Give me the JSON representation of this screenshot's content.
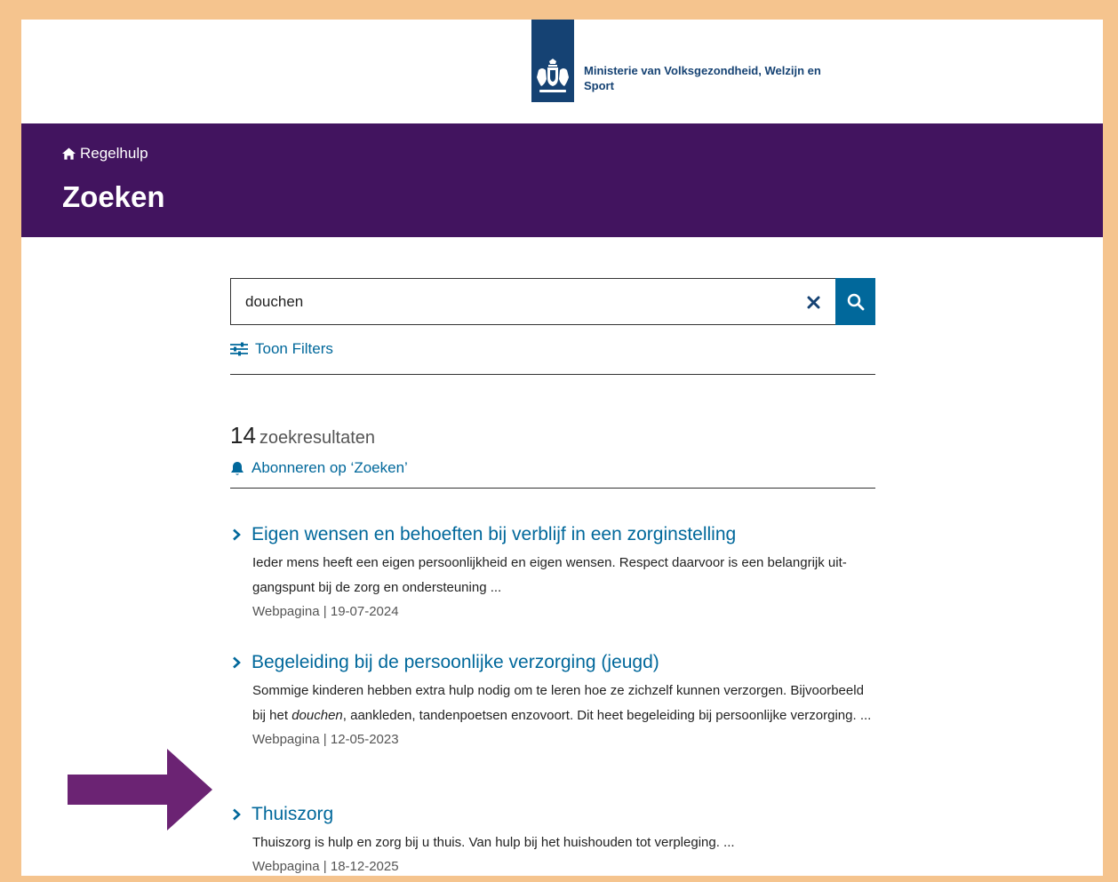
{
  "header": {
    "ministry_name": "Ministerie van Volksgezondheid, Welzijn en Sport",
    "logo_color": "#154273"
  },
  "banner": {
    "breadcrumb": "Regelhulp",
    "title": "Zoeken",
    "color": "#42145f"
  },
  "search": {
    "value": "douchen",
    "clear_icon": "close-icon",
    "search_icon": "search-icon"
  },
  "filters": {
    "toggle_label": "Toon Filters"
  },
  "results_summary": {
    "count": "14",
    "label": "zoekresultaten",
    "subscribe_label": "Abonneren op ‘Zoeken’"
  },
  "results": [
    {
      "title": "Eigen wensen en behoeften bij verblijf in een zorginstelling",
      "desc_parts": [
        "Ieder mens heeft een eigen persoonlijkheid en eigen wensen. Respect daarvoor is een belangrijk uit-gangspunt bij de zorg en ondersteuning ..."
      ],
      "meta": "Webpagina | 19-07-2024"
    },
    {
      "title": "Begeleiding bij de persoonlijke verzorging (jeugd)",
      "desc_before": "Sommige kinderen hebben extra hulp nodig om te leren hoe ze zichzelf kunnen verzorgen. Bijvoorbeeld bij het ",
      "desc_highlight": "douchen",
      "desc_after": ", aankleden, tandenpoetsen enzovoort. Dit heet begeleiding bij persoonlijke verzorging. ...",
      "meta": "Webpagina | 12-05-2023"
    },
    {
      "title": "Thuiszorg",
      "desc_parts": [
        "Thuiszorg is hulp en zorg bij u thuis. Van hulp bij het huishouden tot verpleging. ..."
      ],
      "meta": "Webpagina | 18-12-2025"
    }
  ],
  "colors": {
    "link": "#01689b",
    "annotation_arrow": "#6b2373",
    "frame": "#f5c48e"
  }
}
